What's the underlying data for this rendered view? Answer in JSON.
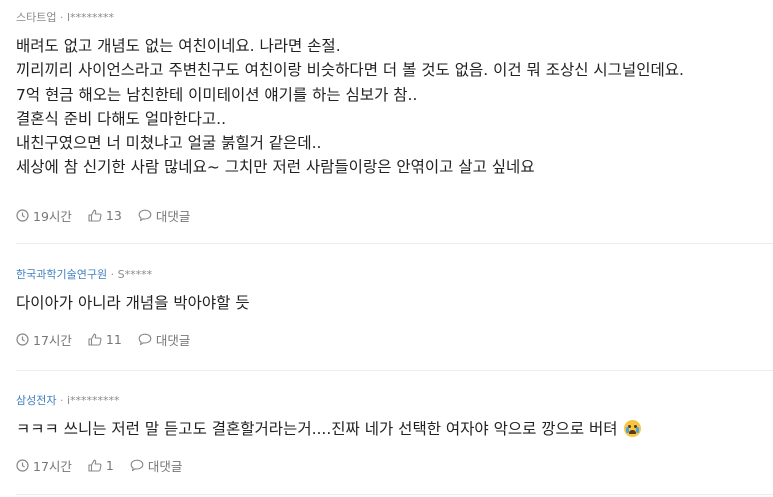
{
  "comments": [
    {
      "company": "스타트업",
      "user": "l********",
      "lines": [
        "배려도 없고 개념도 없는 여친이네요. 나라면 손절.",
        "끼리끼리 사이언스라고 주변친구도 여친이랑 비슷하다면 더 볼 것도 없음. 이건 뭐 조상신 시그널인데요.",
        "7억 현금 해오는 남친한테 이미테이션 얘기를 하는 심보가 참..",
        "결혼식 준비 다해도 얼마한다고..",
        "내친구였으면 너 미쳤냐고 얼굴 붉힐거 같은데..",
        "세상에 참 신기한 사람 많네요~ 그치만 저런 사람들이랑은 안엮이고 살고 싶네요"
      ],
      "time": "19시간",
      "likes": "13",
      "reply": "대댓글"
    },
    {
      "company": "한국과학기술연구원",
      "user": "S*****",
      "lines": [
        "다이아가 아니라 개념을 박아야할 듯"
      ],
      "time": "17시간",
      "likes": "11",
      "reply": "대댓글"
    },
    {
      "company": "삼성전자",
      "user": "i*********",
      "lines": [
        "ㅋㅋㅋ 쓰니는 저런 말 듣고도 결혼할거라는거....진짜 네가 선택한 여자야 악으로 깡으로 버텨"
      ],
      "emoji": "crying-face-emoji",
      "time": "17시간",
      "likes": "1",
      "reply": "대댓글"
    }
  ],
  "separator": "·",
  "icons": {
    "time": "clock-icon",
    "like": "thumbs-up-icon",
    "reply": "speech-bubble-icon"
  },
  "colors": {
    "company_link": "#3f7fbf",
    "meta": "#8a8a8a",
    "text": "#222222",
    "divider": "#ececec"
  }
}
